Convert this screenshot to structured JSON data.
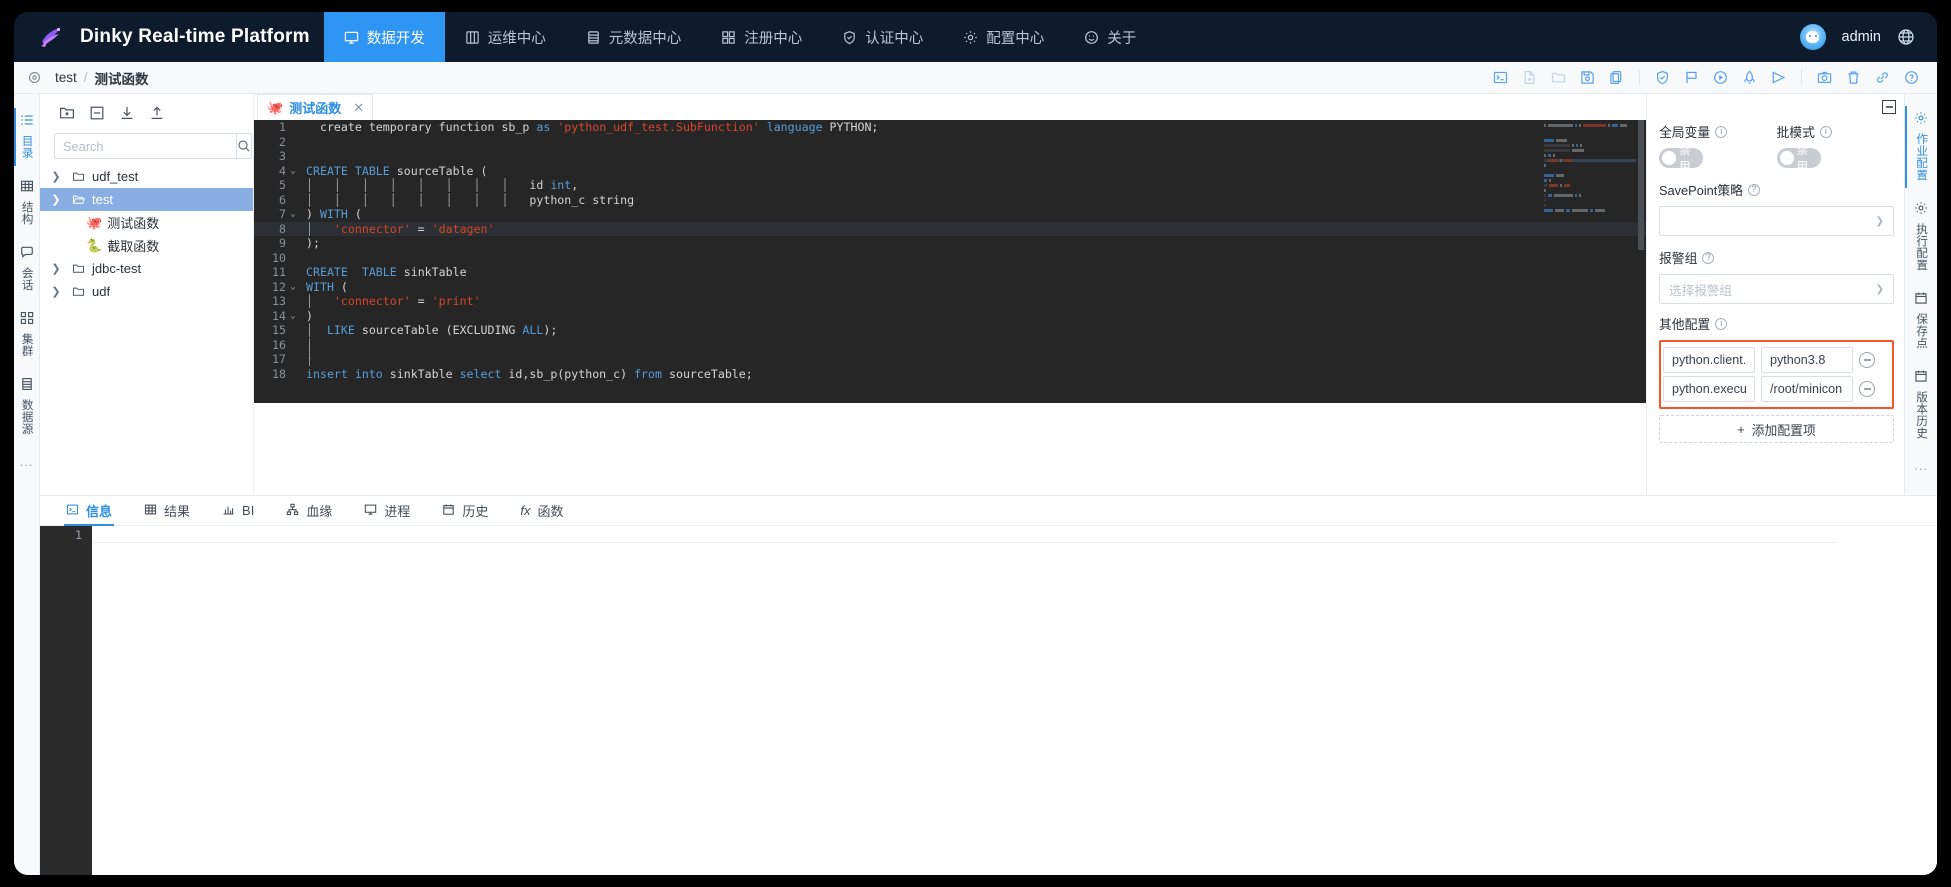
{
  "app": {
    "brand": "Dinky Real-time Platform",
    "logo_icon": "hummingbird-logo"
  },
  "topnav": {
    "items": [
      {
        "label": "数据开发",
        "icon": "monitor-icon",
        "active": true
      },
      {
        "label": "运维中心",
        "icon": "dashboard-icon",
        "active": false
      },
      {
        "label": "元数据中心",
        "icon": "database-icon",
        "active": false
      },
      {
        "label": "注册中心",
        "icon": "grid-icon",
        "active": false
      },
      {
        "label": "认证中心",
        "icon": "shield-check-icon",
        "active": false
      },
      {
        "label": "配置中心",
        "icon": "gear-icon",
        "active": false
      },
      {
        "label": "关于",
        "icon": "smile-icon",
        "active": false
      }
    ],
    "user": "admin",
    "language_icon": "globe-icon",
    "active_color": "#2f95f2"
  },
  "breadcrumb": {
    "target_icon": "target-icon",
    "root": "test",
    "separator": "/",
    "leaf": "测试函数"
  },
  "toolbar": {
    "buttons": [
      {
        "name": "terminal-icon",
        "enabled": true
      },
      {
        "name": "new-file-icon",
        "enabled": false
      },
      {
        "name": "open-folder-icon",
        "enabled": false
      },
      {
        "name": "save-icon",
        "enabled": true
      },
      {
        "name": "copy-icon",
        "enabled": true
      },
      {
        "name": "divider",
        "enabled": true
      },
      {
        "name": "shield-check-icon",
        "enabled": true
      },
      {
        "name": "flag-icon",
        "enabled": true
      },
      {
        "name": "play-circle-icon",
        "enabled": true
      },
      {
        "name": "rocket-icon",
        "enabled": true
      },
      {
        "name": "send-icon",
        "enabled": true
      },
      {
        "name": "divider",
        "enabled": true
      },
      {
        "name": "camera-icon",
        "enabled": true
      },
      {
        "name": "trash-icon",
        "enabled": true
      },
      {
        "name": "link-icon",
        "enabled": true
      },
      {
        "name": "question-circle-icon",
        "enabled": true
      }
    ]
  },
  "left_rail": {
    "items": [
      {
        "label": "目录",
        "icon": "list-icon",
        "active": true
      },
      {
        "label": "结构",
        "icon": "table-icon",
        "active": false
      },
      {
        "label": "会话",
        "icon": "chat-icon",
        "active": false
      },
      {
        "label": "集群",
        "icon": "cluster-icon",
        "active": false
      },
      {
        "label": "数据源",
        "icon": "database-icon",
        "active": false
      }
    ],
    "more": "..."
  },
  "tree_panel": {
    "tools": [
      {
        "name": "new-folder-icon"
      },
      {
        "name": "collapse-all-icon"
      },
      {
        "name": "download-icon"
      },
      {
        "name": "upload-icon"
      }
    ],
    "search": {
      "placeholder": "Search",
      "value": "",
      "icon": "search-icon"
    },
    "nodes": [
      {
        "label": "udf_test",
        "type": "folder",
        "expanded": false,
        "depth": 0,
        "selected": false,
        "icon": "folder-icon"
      },
      {
        "label": "test",
        "type": "folder",
        "expanded": true,
        "depth": 0,
        "selected": true,
        "icon": "folder-open-icon"
      },
      {
        "label": "测试函数",
        "type": "file",
        "depth": 1,
        "selected": false,
        "icon": "scala-icon",
        "emoji": "🐙"
      },
      {
        "label": "截取函数",
        "type": "file",
        "depth": 1,
        "selected": false,
        "icon": "python-icon",
        "emoji": "🐍"
      },
      {
        "label": "jdbc-test",
        "type": "folder",
        "expanded": false,
        "depth": 0,
        "selected": false,
        "icon": "folder-icon"
      },
      {
        "label": "udf",
        "type": "folder",
        "expanded": false,
        "depth": 0,
        "selected": false,
        "icon": "folder-icon"
      }
    ]
  },
  "editor": {
    "tab": {
      "label": "测试函数",
      "icon": "scala-icon",
      "close_icon": "close-icon",
      "active": true
    },
    "collapse_icon": "collapse-panel-icon",
    "highlight_line": 8,
    "lines": [
      {
        "n": 1,
        "fold": "",
        "tokens": [
          {
            "t": "  ",
            "c": "t"
          },
          {
            "t": "create temporary function sb_p ",
            "c": "t"
          },
          {
            "t": "as",
            "c": "k"
          },
          {
            "t": " ",
            "c": "t"
          },
          {
            "t": "'python_udf_test.SubFunction'",
            "c": "s"
          },
          {
            "t": " ",
            "c": "t"
          },
          {
            "t": "language",
            "c": "k"
          },
          {
            "t": " PYTHON;",
            "c": "t"
          }
        ]
      },
      {
        "n": 2,
        "fold": "",
        "tokens": []
      },
      {
        "n": 3,
        "fold": "",
        "tokens": []
      },
      {
        "n": 4,
        "fold": "v",
        "tokens": [
          {
            "t": "CREATE TABLE",
            "c": "k"
          },
          {
            "t": " sourceTable (",
            "c": "t"
          }
        ]
      },
      {
        "n": 5,
        "fold": "",
        "tokens": [
          {
            "t": "│   │   │   │   │   │   │   │   ",
            "c": "g"
          },
          {
            "t": "id ",
            "c": "t"
          },
          {
            "t": "int",
            "c": "k"
          },
          {
            "t": ",",
            "c": "t"
          }
        ]
      },
      {
        "n": 6,
        "fold": "",
        "tokens": [
          {
            "t": "│   │   │   │   │   │   │   │   ",
            "c": "g"
          },
          {
            "t": "python_c string",
            "c": "t"
          }
        ]
      },
      {
        "n": 7,
        "fold": "v",
        "tokens": [
          {
            "t": ") ",
            "c": "t"
          },
          {
            "t": "WITH",
            "c": "k"
          },
          {
            "t": " (",
            "c": "t"
          }
        ]
      },
      {
        "n": 8,
        "fold": "",
        "tokens": [
          {
            "t": "│   ",
            "c": "g"
          },
          {
            "t": "'connector'",
            "c": "s"
          },
          {
            "t": " = ",
            "c": "t"
          },
          {
            "t": "'datagen'",
            "c": "s"
          }
        ]
      },
      {
        "n": 9,
        "fold": "",
        "tokens": [
          {
            "t": ");",
            "c": "t"
          }
        ]
      },
      {
        "n": 10,
        "fold": "",
        "tokens": []
      },
      {
        "n": 11,
        "fold": "",
        "tokens": [
          {
            "t": "CREATE  TABLE",
            "c": "k"
          },
          {
            "t": " sinkTable",
            "c": "t"
          }
        ]
      },
      {
        "n": 12,
        "fold": "v",
        "tokens": [
          {
            "t": "WITH",
            "c": "k"
          },
          {
            "t": " (",
            "c": "t"
          }
        ]
      },
      {
        "n": 13,
        "fold": "",
        "tokens": [
          {
            "t": "│   ",
            "c": "g"
          },
          {
            "t": "'connector'",
            "c": "s"
          },
          {
            "t": " = ",
            "c": "t"
          },
          {
            "t": "'print'",
            "c": "s"
          }
        ]
      },
      {
        "n": 14,
        "fold": "v",
        "tokens": [
          {
            "t": ")",
            "c": "t"
          }
        ]
      },
      {
        "n": 15,
        "fold": "",
        "tokens": [
          {
            "t": "│  ",
            "c": "g"
          },
          {
            "t": "LIKE",
            "c": "k"
          },
          {
            "t": " sourceTable (EXCLUDING ",
            "c": "t"
          },
          {
            "t": "ALL",
            "c": "k"
          },
          {
            "t": ");",
            "c": "t"
          }
        ]
      },
      {
        "n": 16,
        "fold": "",
        "tokens": [
          {
            "t": "│",
            "c": "g"
          }
        ]
      },
      {
        "n": 17,
        "fold": "",
        "tokens": [
          {
            "t": "│",
            "c": "g"
          }
        ]
      },
      {
        "n": 18,
        "fold": "",
        "tokens": [
          {
            "t": "insert into",
            "c": "k"
          },
          {
            "t": " sinkTable ",
            "c": "t"
          },
          {
            "t": "select",
            "c": "k"
          },
          {
            "t": " id,sb_p(python_c) ",
            "c": "t"
          },
          {
            "t": "from",
            "c": "k"
          },
          {
            "t": " sourceTable;",
            "c": "t"
          }
        ]
      }
    ]
  },
  "config_panel": {
    "global_var": {
      "label": "全局变量",
      "info_icon": "info-icon",
      "switch_text": "禁用",
      "enabled": false
    },
    "batch_mode": {
      "label": "批模式",
      "info_icon": "info-icon",
      "switch_text": "禁用",
      "enabled": false
    },
    "savepoint": {
      "label": "SavePoint策略",
      "help_icon": "question-icon",
      "value": "",
      "placeholder": ""
    },
    "alert_group": {
      "label": "报警组",
      "help_icon": "question-icon",
      "value": "",
      "placeholder": "选择报警组"
    },
    "other_config": {
      "label": "其他配置",
      "info_icon": "info-icon",
      "highlight_color": "#f4562a",
      "rows": [
        {
          "key": "python.client.",
          "value": "python3.8",
          "remove_icon": "minus-circle-icon"
        },
        {
          "key": "python.execu",
          "value": "/root/minicon",
          "remove_icon": "minus-circle-icon"
        }
      ],
      "add_label": "添加配置项",
      "add_icon": "plus-icon"
    }
  },
  "right_rail": {
    "items": [
      {
        "label": "作业配置",
        "icon": "gear-icon",
        "active": true
      },
      {
        "label": "执行配置",
        "icon": "gear-icon",
        "active": false
      },
      {
        "label": "保存点",
        "icon": "calendar-icon",
        "active": false
      },
      {
        "label": "版本历史",
        "icon": "calendar-icon",
        "active": false
      }
    ],
    "more": "..."
  },
  "bottom_panel": {
    "tabs": [
      {
        "label": "信息",
        "icon": "console-icon",
        "active": true
      },
      {
        "label": "结果",
        "icon": "table-icon",
        "active": false
      },
      {
        "label": "BI",
        "icon": "chart-icon",
        "active": false
      },
      {
        "label": "血缘",
        "icon": "lineage-icon",
        "active": false
      },
      {
        "label": "进程",
        "icon": "monitor-icon",
        "active": false
      },
      {
        "label": "历史",
        "icon": "calendar-icon",
        "active": false
      },
      {
        "label": "函数",
        "icon": "fx-icon",
        "active": false
      }
    ],
    "log_line_number": "1",
    "log_content": ""
  }
}
